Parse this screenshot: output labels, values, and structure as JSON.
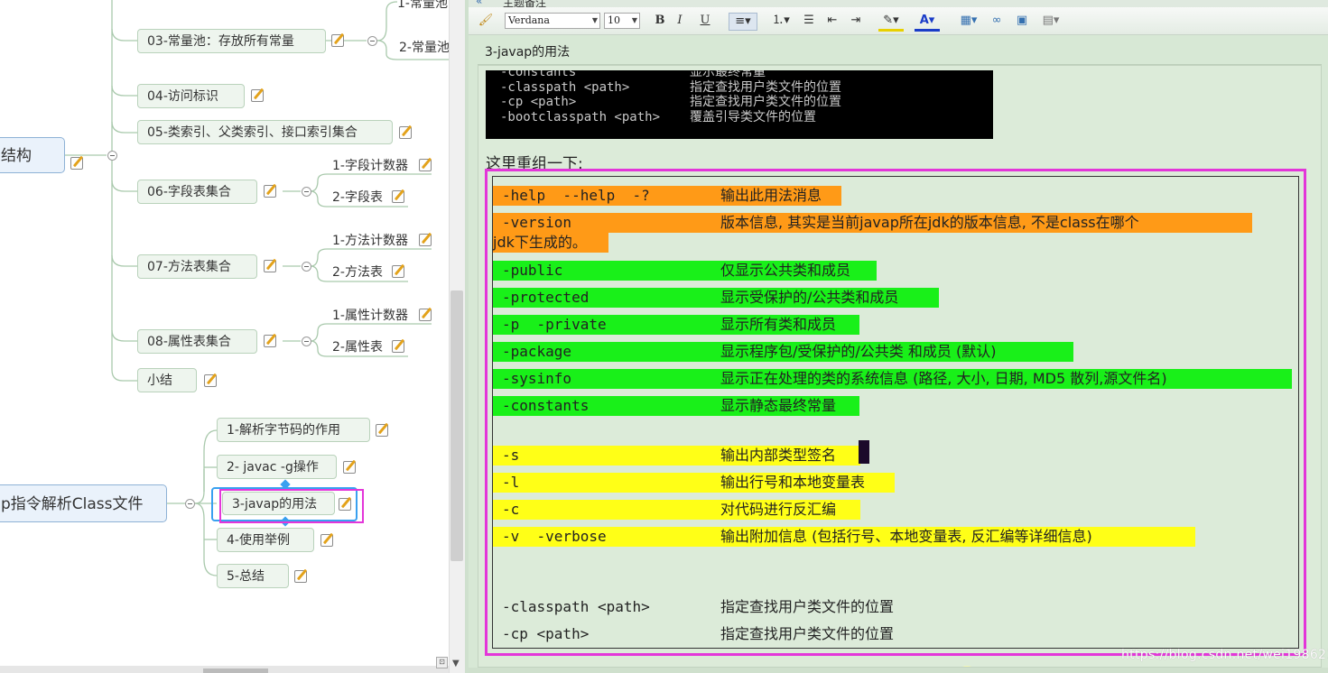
{
  "mindmap": {
    "top_leaves": [
      "1-常量池",
      "2-常量池"
    ],
    "node_03": "03-常量池：存放所有常量",
    "node_04": "04-访问标识",
    "node_05": "05-类索引、父类索引、接口索引集合",
    "node_06": "06-字段表集合",
    "node_06_children": [
      "1-字段计数器",
      "2-字段表"
    ],
    "node_07": "07-方法表集合",
    "node_07_children": [
      "1-方法计数器",
      "2-方法表"
    ],
    "node_08": "08-属性表集合",
    "node_08_children": [
      "1-属性计数器",
      "2-属性表"
    ],
    "summary": "小结",
    "root_structure": "结构",
    "root_javap": "p指令解析Class文件",
    "javap_children": [
      "1-解析字节码的作用",
      "2- javac -g操作",
      "3-javap的用法",
      "4-使用举例",
      "5-总结"
    ]
  },
  "editor": {
    "panel_title": "主题备注",
    "toolbar": {
      "font": "Verdana",
      "size": "10",
      "bold": "B",
      "italic": "I",
      "underline": "U"
    },
    "topic_title": "3-javap的用法",
    "console_lines": [
      {
        "opt": "-constants",
        "desc": "显示最终常量"
      },
      {
        "opt": "-classpath <path>",
        "desc": "指定查找用户类文件的位置"
      },
      {
        "opt": "-cp <path>",
        "desc": "指定查找用户类文件的位置"
      },
      {
        "opt": "-bootclasspath <path>",
        "desc": "覆盖引导类文件的位置"
      }
    ],
    "intro": "这里重组一下:",
    "options": {
      "help": {
        "opt": "-help  --help  -?",
        "desc": "输出此用法消息"
      },
      "version": {
        "opt": "-version",
        "desc": "版本信息, 其实是当前javap所在jdk的版本信息, 不是class在哪个",
        "desc2": "jdk下生成的。"
      },
      "public": {
        "opt": "-public",
        "desc": "仅显示公共类和成员"
      },
      "protected": {
        "opt": "-protected",
        "desc": "显示受保护的/公共类和成员"
      },
      "private": {
        "opt": "-p  -private",
        "desc": "显示所有类和成员"
      },
      "package": {
        "opt": "-package",
        "desc": "显示程序包/受保护的/公共类 和成员 (默认)"
      },
      "sysinfo": {
        "opt": "-sysinfo",
        "desc": "显示正在处理的类的系统信息 (路径, 大小, 日期, MD5 散列,源文件名)"
      },
      "constants": {
        "opt": "-constants",
        "desc": "显示静态最终常量"
      },
      "s": {
        "opt": "-s",
        "desc": "输出内部类型签名"
      },
      "l": {
        "opt": "-l",
        "desc": "输出行号和本地变量表"
      },
      "c": {
        "opt": "-c",
        "desc": "对代码进行反汇编"
      },
      "v": {
        "opt": "-v  -verbose",
        "desc": "输出附加信息 (包括行号、本地变量表, 反汇编等详细信息)"
      },
      "classpath": {
        "opt": "-classpath <path>",
        "desc": "指定查找用户类文件的位置"
      },
      "cp": {
        "opt": "-cp <path>",
        "desc": "指定查找用户类文件的位置"
      }
    },
    "ibeam": "I",
    "watermark": "https://blog.csdn.net/wei198621"
  },
  "colors": {
    "highlight_orange": "#ff9a17",
    "highlight_green": "#19f019",
    "highlight_yellow": "#ffff17",
    "selection_box": "#e336d9",
    "editor_bg": "#dcebd9"
  }
}
